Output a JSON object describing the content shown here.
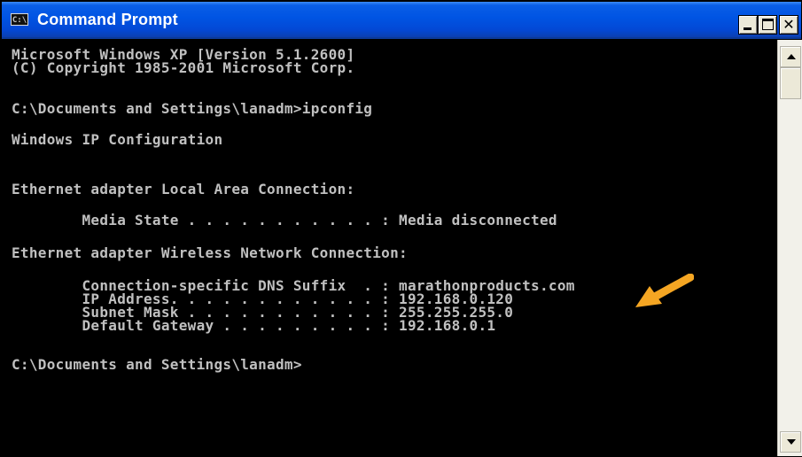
{
  "window": {
    "title": "Command Prompt",
    "icon": "cmd-icon",
    "controls": [
      "minimize-icon",
      "maximize-icon",
      "close-icon"
    ]
  },
  "console": {
    "lines": [
      "Microsoft Windows XP [Version 5.1.2600]",
      "(C) Copyright 1985-2001 Microsoft Corp.",
      "C:\\Documents and Settings\\lanadm>ipconfig",
      "Windows IP Configuration",
      "Ethernet adapter Local Area Connection:",
      "        Media State . . . . . . . . . . . : Media disconnected",
      "Ethernet adapter Wireless Network Connection:",
      "        Connection-specific DNS Suffix  . : marathonproducts.com",
      "        IP Address. . . . . . . . . . . . : 192.168.0.120",
      "        Subnet Mask . . . . . . . . . . . : 255.255.255.0",
      "        Default Gateway . . . . . . . . . : 192.168.0.1",
      "C:\\Documents and Settings\\lanadm>"
    ]
  },
  "annotation": {
    "icon": "arrow-pointer-icon",
    "color": "#f5a623"
  },
  "scrollbar": {
    "icons": [
      "scroll-up-arrow-icon",
      "scroll-down-arrow-icon"
    ]
  }
}
